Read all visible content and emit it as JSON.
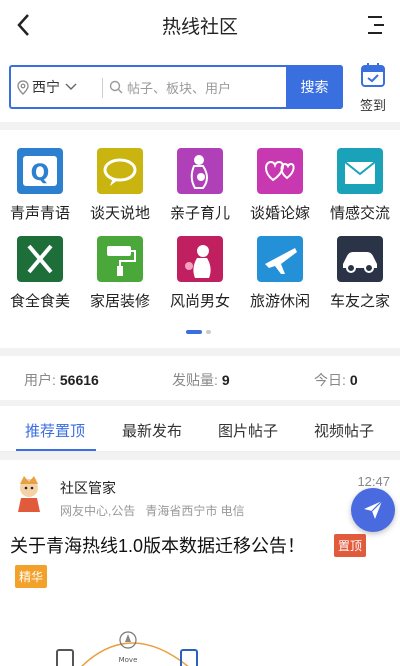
{
  "header": {
    "title": "热线社区",
    "back_icon": "chevron-left-icon",
    "menu_icon": "menu-icon"
  },
  "search": {
    "city": "西宁",
    "placeholder": "帖子、板块、用户",
    "button": "搜索"
  },
  "checkin": {
    "label": "签到",
    "icon": "calendar-check-icon"
  },
  "categories": [
    {
      "label": "青声青语",
      "icon": "speech-q-icon",
      "color": "#2d7fd0"
    },
    {
      "label": "谈天说地",
      "icon": "chat-bubble-icon",
      "color": "#c9b410"
    },
    {
      "label": "亲子育儿",
      "icon": "mother-child-icon",
      "color": "#b040b8"
    },
    {
      "label": "谈婚论嫁",
      "icon": "hearts-icon",
      "color": "#c838b0"
    },
    {
      "label": "情感交流",
      "icon": "letter-icon",
      "color": "#1aa3b8"
    },
    {
      "label": "食全食美",
      "icon": "fork-knife-icon",
      "color": "#1e6e3a"
    },
    {
      "label": "家居装修",
      "icon": "paint-roller-icon",
      "color": "#4aa83a"
    },
    {
      "label": "风尚男女",
      "icon": "fashion-icon",
      "color": "#c02060"
    },
    {
      "label": "旅游休闲",
      "icon": "airplane-icon",
      "color": "#2490d8"
    },
    {
      "label": "车友之家",
      "icon": "car-icon",
      "color": "#2a3446"
    }
  ],
  "stats": {
    "users_label": "用户:",
    "users_value": "56616",
    "posts_label": "发贴量:",
    "posts_value": "9",
    "today_label": "今日:",
    "today_value": "0"
  },
  "tabs": [
    "推荐置顶",
    "最新发布",
    "图片帖子",
    "视频帖子"
  ],
  "post": {
    "author": "社区管家",
    "meta": [
      "网友中心,公告",
      "青海省西宁市 电信"
    ],
    "time": "12:47",
    "title": "关于青海热线1.0版本数据迁移公告！",
    "badge_top": "置顶",
    "badge_essence": "精华",
    "thumb_label": "Move"
  },
  "fab_icon": "send-icon",
  "colors": {
    "accent": "#3a6fe0",
    "top_badge": "#e25a3c",
    "essence_badge": "#f2a12a"
  }
}
